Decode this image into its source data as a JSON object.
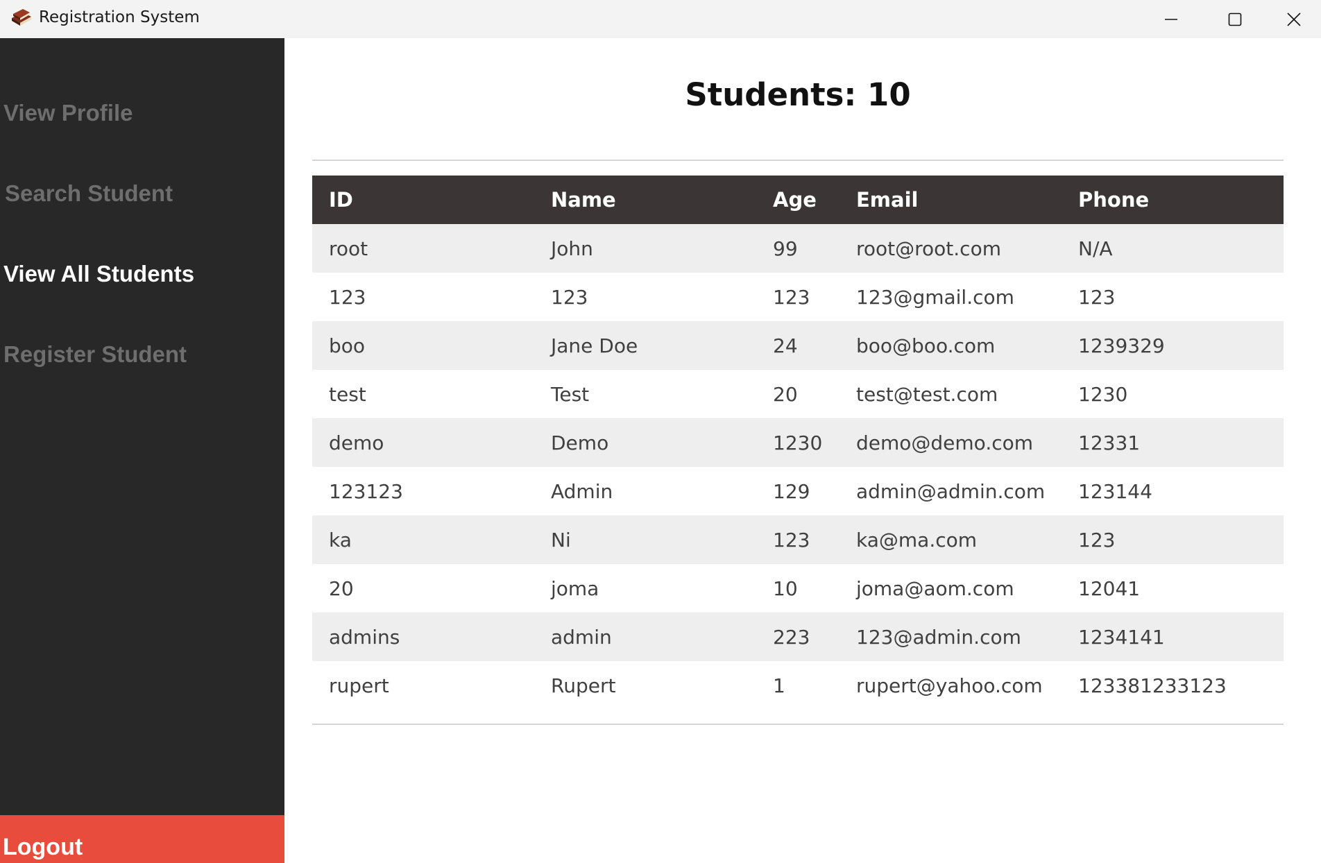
{
  "window": {
    "title": "Registration System"
  },
  "sidebar": {
    "items": [
      {
        "label": "View Profile",
        "active": false
      },
      {
        "label": "Search Student",
        "active": false
      },
      {
        "label": "View All Students",
        "active": true
      },
      {
        "label": "Register Student",
        "active": false
      }
    ],
    "logout_label": "Logout"
  },
  "main": {
    "title": "Students: 10",
    "table": {
      "headers": [
        "ID",
        "Name",
        "Age",
        "Email",
        "Phone"
      ],
      "rows": [
        [
          "root",
          "John",
          "99",
          "root@root.com",
          "N/A"
        ],
        [
          "123",
          "123",
          "123",
          "123@gmail.com",
          "123"
        ],
        [
          "boo",
          "Jane Doe",
          "24",
          "boo@boo.com",
          "1239329"
        ],
        [
          "test",
          "Test",
          "20",
          "test@test.com",
          "1230"
        ],
        [
          "demo",
          "Demo",
          "1230",
          "demo@demo.com",
          "12331"
        ],
        [
          "123123",
          "Admin",
          "129",
          "admin@admin.com",
          "123144"
        ],
        [
          "ka",
          "Ni",
          "123",
          "ka@ma.com",
          "123"
        ],
        [
          "20",
          "joma",
          "10",
          "joma@aom.com",
          "12041"
        ],
        [
          "admins",
          "admin",
          "223",
          "123@admin.com",
          "1234141"
        ],
        [
          "rupert",
          "Rupert",
          "1",
          "rupert@yahoo.com",
          "123381233123"
        ]
      ]
    }
  },
  "colors": {
    "sidebar_bg": "#282828",
    "nav_inactive": "#6e6e6e",
    "nav_active": "#ffffff",
    "logout_bg": "#e74c3c",
    "table_header_bg": "#3b3535",
    "row_alt_bg": "#eeeeee"
  },
  "icons": {
    "app": "book-stack-icon",
    "minimize": "minimize-icon",
    "maximize": "maximize-icon",
    "close": "close-icon"
  }
}
